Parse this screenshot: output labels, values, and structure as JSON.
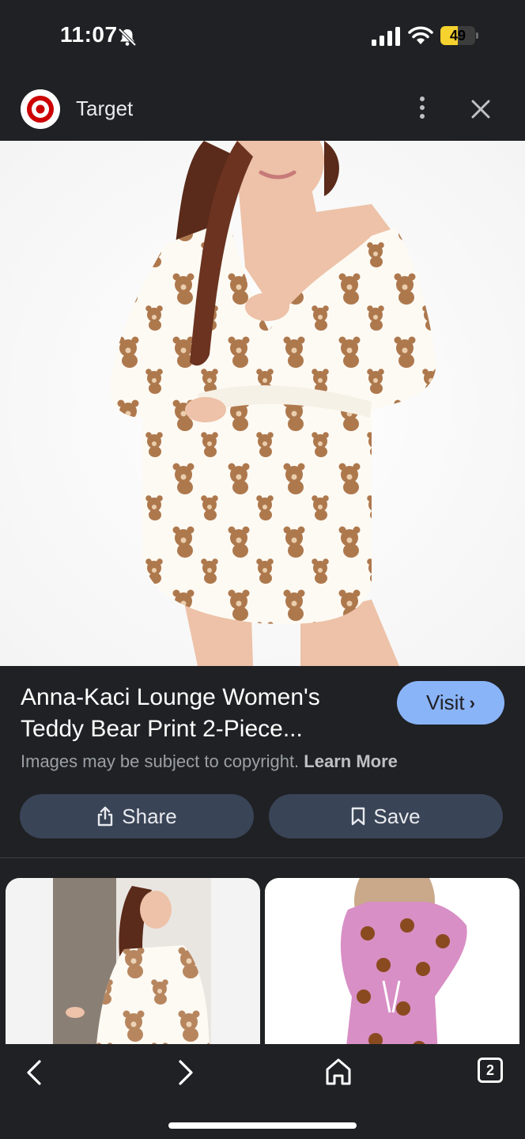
{
  "status_bar": {
    "time": "11:07",
    "battery_level": "49",
    "battery_fraction": 0.49,
    "icons": [
      "bell-muted-icon",
      "cellular-signal-icon",
      "wifi-icon",
      "battery-icon"
    ]
  },
  "header": {
    "site_name": "Target",
    "logo_icon": "target-bullseye-logo",
    "more_icon": "more-vert-icon",
    "close_icon": "close-icon"
  },
  "result": {
    "title": "Anna-Kaci Lounge Women's Teddy Bear Print 2-Piece...",
    "visit_label": "Visit",
    "copyright_text": "Images may be subject to copyright.",
    "learn_more_label": "Learn More",
    "share_label": "Share",
    "save_label": "Save"
  },
  "bottom_bar": {
    "tab_count": "2",
    "icons": [
      "back-icon",
      "forward-icon",
      "home-icon",
      "tabs-icon"
    ]
  },
  "colors": {
    "background": "#202124",
    "accent_button": "#8ab4f8",
    "action_button": "#394457",
    "brand_red": "#cc0000"
  }
}
